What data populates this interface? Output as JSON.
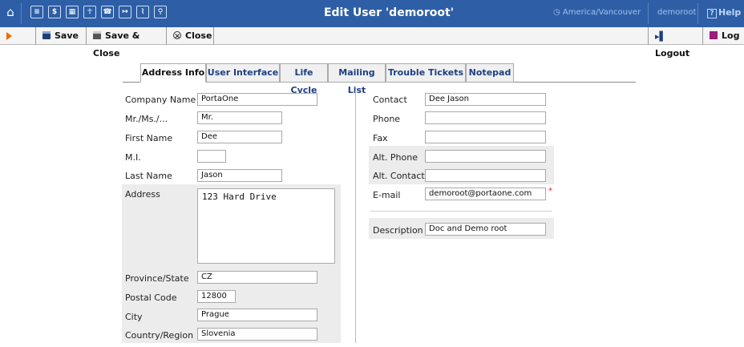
{
  "window": {
    "title": "Edit User 'demoroot'",
    "timezone": "America/Vancouver",
    "user": "demoroot",
    "help": "Help"
  },
  "toolbar": {
    "save": "Save",
    "save_close": "Save & Close",
    "close": "Close",
    "logout": "Logout",
    "log": "Log"
  },
  "tabs": [
    "Address Info",
    "User Interface",
    "Life Cycle",
    "Mailing List",
    "Trouble Tickets",
    "Notepad"
  ],
  "form_left": {
    "company_name": {
      "label": "Company Name",
      "value": "PortaOne"
    },
    "salutation": {
      "label": "Mr./Ms./...",
      "value": "Mr."
    },
    "first_name": {
      "label": "First Name",
      "value": "Dee"
    },
    "mi": {
      "label": "M.I.",
      "value": ""
    },
    "last_name": {
      "label": "Last Name",
      "value": "Jason"
    },
    "address": {
      "label": "Address",
      "value": "123 Hard Drive"
    },
    "province": {
      "label": "Province/State",
      "value": "CZ"
    },
    "postal_code": {
      "label": "Postal Code",
      "value": "12800"
    },
    "city": {
      "label": "City",
      "value": "Prague"
    },
    "country": {
      "label": "Country/Region",
      "value": "Slovenia"
    }
  },
  "form_right": {
    "contact": {
      "label": "Contact",
      "value": "Dee Jason"
    },
    "phone": {
      "label": "Phone",
      "value": ""
    },
    "fax": {
      "label": "Fax",
      "value": ""
    },
    "alt_phone": {
      "label": "Alt. Phone",
      "value": ""
    },
    "alt_contact": {
      "label": "Alt. Contact",
      "value": ""
    },
    "email": {
      "label": "E-mail",
      "value": "demoroot@portaone.com",
      "required_mark": "*"
    },
    "description": {
      "label": "Description",
      "value": "Doc and Demo root"
    }
  },
  "colors": {
    "titlebar": "#2e5fa6",
    "tab_text": "#1c3f85",
    "accent": "#e86d00"
  }
}
